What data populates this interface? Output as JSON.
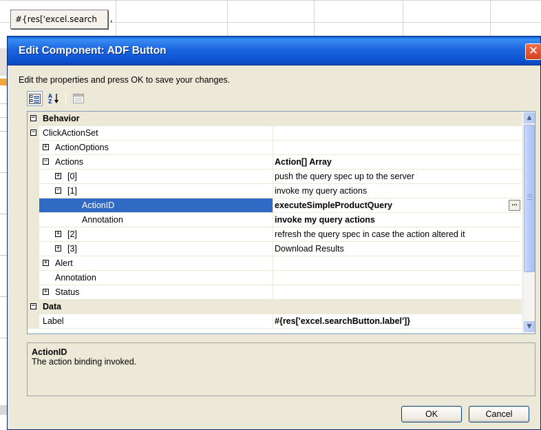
{
  "background": {
    "cell_text": "#{res['excel.search"
  },
  "dialog": {
    "title": "Edit Component: ADF Button",
    "close_glyph": "✕",
    "instruction": "Edit the properties and press OK to save your changes."
  },
  "toolbar": {
    "categorized_icon": "categorized-view-icon",
    "alphabetical_icon": "sort-az-icon",
    "property_pages_icon": "property-pages-icon"
  },
  "grid": {
    "rows": [
      {
        "type": "category",
        "name": "Behavior",
        "toggle": "⊟"
      },
      {
        "type": "prop",
        "name": "ClickActionSet",
        "toggle": "−",
        "value": ""
      },
      {
        "type": "prop",
        "name": "ActionOptions",
        "toggle": "+",
        "value": ""
      },
      {
        "type": "prop",
        "name": "Actions",
        "toggle": "−",
        "value": "Action[] Array"
      },
      {
        "type": "prop",
        "name": "[0]",
        "toggle": "+",
        "value": "push the query spec up to the server"
      },
      {
        "type": "prop",
        "name": "[1]",
        "toggle": "−",
        "value": "invoke my query actions"
      },
      {
        "type": "prop",
        "name": "ActionID",
        "toggle": "",
        "value": "executeSimpleProductQuery",
        "selected": true
      },
      {
        "type": "prop",
        "name": "Annotation",
        "toggle": "",
        "value": "invoke my query actions"
      },
      {
        "type": "prop",
        "name": "[2]",
        "toggle": "+",
        "value": "refresh the query spec in case the action altered it"
      },
      {
        "type": "prop",
        "name": "[3]",
        "toggle": "+",
        "value": "Download Results"
      },
      {
        "type": "prop",
        "name": "Alert",
        "toggle": "+",
        "value": ""
      },
      {
        "type": "prop",
        "name": "Annotation",
        "toggle": "",
        "value": ""
      },
      {
        "type": "prop",
        "name": "Status",
        "toggle": "+",
        "value": ""
      },
      {
        "type": "category",
        "name": "Data",
        "toggle": "⊟"
      },
      {
        "type": "prop",
        "name": "Label",
        "toggle": "",
        "value": "#{res['excel.searchButton.label']}"
      }
    ],
    "ellipsis_label": "...",
    "scroll_up": "▲",
    "scroll_down": "▼"
  },
  "description": {
    "title": "ActionID",
    "text": "The action binding invoked."
  },
  "buttons": {
    "ok": "OK",
    "cancel": "Cancel"
  },
  "colors": {
    "title_bar": "#0b53d0",
    "selection": "#316ac5",
    "dialog_face": "#ece9d8"
  }
}
